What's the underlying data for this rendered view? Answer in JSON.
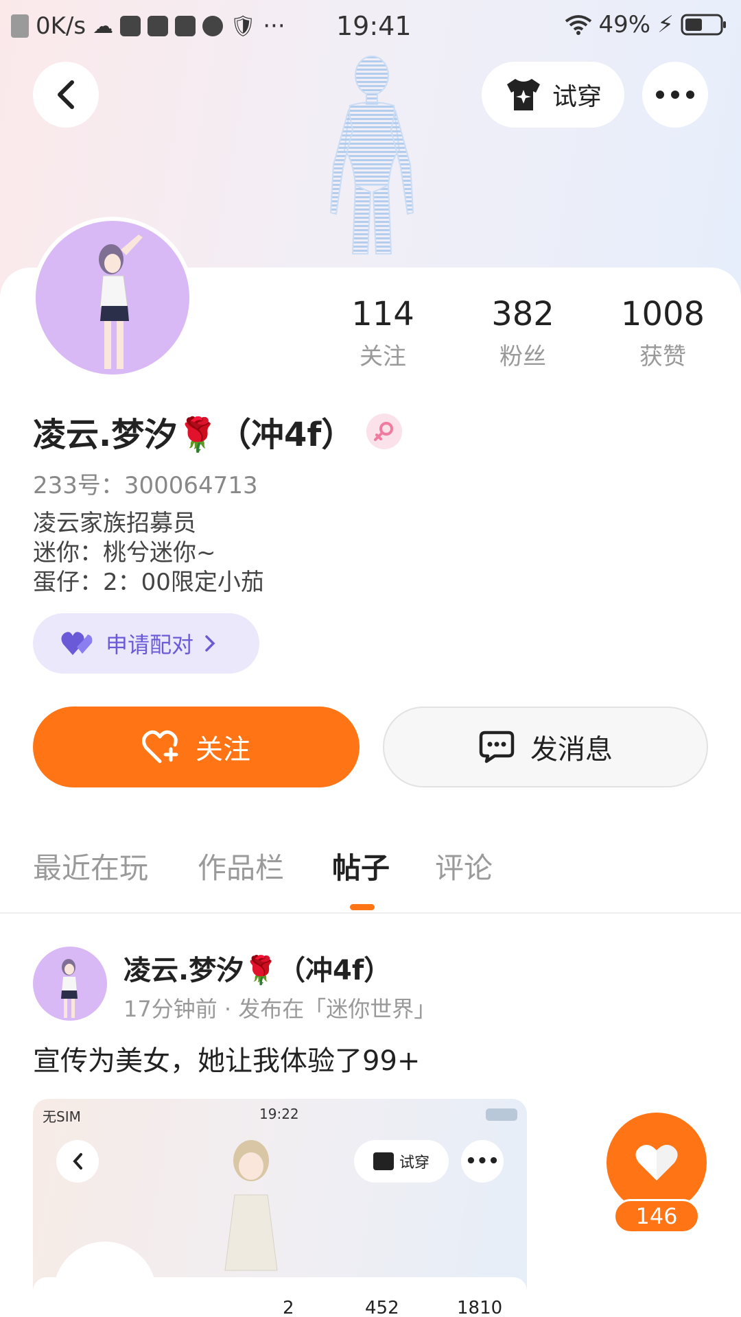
{
  "status_bar": {
    "network_speed": "0K/s",
    "time": "19:41",
    "battery": "49%"
  },
  "header": {
    "tryon_label": "试穿"
  },
  "profile": {
    "stats": [
      {
        "value": "114",
        "label": "关注"
      },
      {
        "value": "382",
        "label": "粉丝"
      },
      {
        "value": "1008",
        "label": "获赞"
      }
    ],
    "name": "凌云.梦汐🌹（冲4f）",
    "id_text": "233号：300064713",
    "bio": [
      "凌云家族招募员",
      "迷你：桃兮迷你~",
      "蛋仔：2：00限定小茄"
    ],
    "pair_label": "申请配对",
    "follow_label": "关注",
    "message_label": "发消息"
  },
  "tabs": [
    {
      "label": "最近在玩",
      "active": false
    },
    {
      "label": "作品栏",
      "active": false
    },
    {
      "label": "帖子",
      "active": true
    },
    {
      "label": "评论",
      "active": false
    }
  ],
  "post": {
    "author": "凌云.梦汐🌹（冲4f）",
    "meta": "17分钟前 · 发布在「迷你世界」",
    "text": "宣传为美女，她让我体验了99+",
    "like_count": "146",
    "image": {
      "status_left": "无SIM",
      "status_time": "19:22",
      "tryon_label": "试穿",
      "stats": [
        "2",
        "452",
        "1810"
      ]
    }
  },
  "colors": {
    "accent": "#ff7414",
    "pair_bg": "#ece8fb",
    "pair_text": "#6a5ad8",
    "avatar_bg": "#d8b8f5"
  }
}
